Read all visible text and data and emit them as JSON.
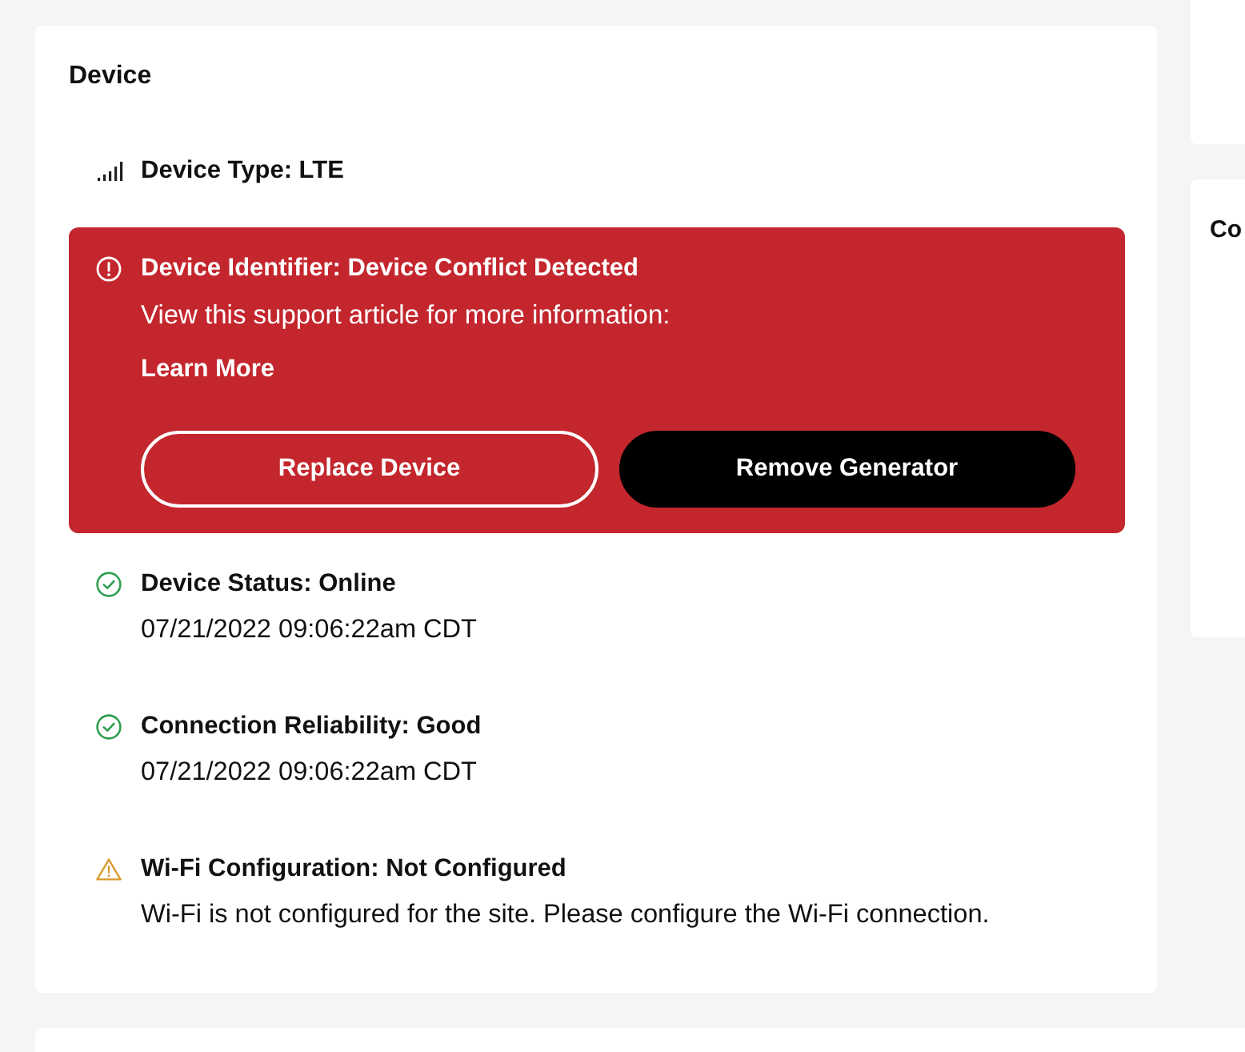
{
  "device_card": {
    "title": "Device",
    "device_type": {
      "label": "Device Type: LTE"
    },
    "alert": {
      "kind": "error",
      "title": "Device Identifier: Device Conflict Detected",
      "message": "View this support article for more information:",
      "link": "Learn More",
      "buttons": [
        {
          "label": "Replace Device",
          "kind": "outline"
        },
        {
          "label": "Remove Generator",
          "kind": "solid"
        }
      ]
    },
    "statuses": [
      {
        "kind": "ok",
        "title": "Device Status: Online",
        "detail": "07/21/2022 09:06:22am CDT"
      },
      {
        "kind": "ok",
        "title": "Connection Reliability: Good",
        "detail": "07/21/2022 09:06:22am CDT"
      },
      {
        "kind": "warning",
        "title": "Wi-Fi Configuration: Not Configured",
        "detail": "Wi-Fi is not configured for the site. Please configure the Wi-Fi connection."
      }
    ]
  },
  "side_card": {
    "title": "Co"
  }
}
